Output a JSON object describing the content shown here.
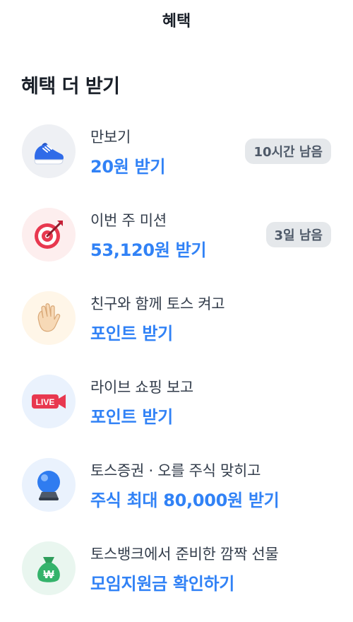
{
  "header": {
    "title": "혜택"
  },
  "section": {
    "title": "혜택 더 받기"
  },
  "items": [
    {
      "subtitle": "만보기",
      "action": "20원 받기",
      "badge": "10시간 남음",
      "icon": "sneaker-icon",
      "bg": "#eef0f4"
    },
    {
      "subtitle": "이번 주 미션",
      "action": "53,120원 받기",
      "badge": "3일 남음",
      "icon": "dart-target-icon",
      "bg": "#fdeeee"
    },
    {
      "subtitle": "친구와 함께 토스 켜고",
      "action": "포인트 받기",
      "icon": "waving-hand-icon",
      "bg": "#fff6e8"
    },
    {
      "subtitle": "라이브 쇼핑 보고",
      "action": "포인트 받기",
      "icon": "live-camera-icon",
      "live_label": "LIVE",
      "bg": "#eaf2fd"
    },
    {
      "subtitle": "토스증권 · 오를 주식 맞히고",
      "action": "주식 최대 80,000원 받기",
      "icon": "crystal-ball-icon",
      "bg": "#eaf2fd"
    },
    {
      "subtitle": "토스뱅크에서 준비한 깜짝 선물",
      "action": "모임지원금 확인하기",
      "icon": "money-bag-icon",
      "money_symbol": "₩",
      "bg": "#e9f6ef"
    }
  ],
  "colors": {
    "accent": "#3182f6",
    "text": "#191f28",
    "badge_bg": "#e5e8eb",
    "badge_text": "#4e5968"
  }
}
